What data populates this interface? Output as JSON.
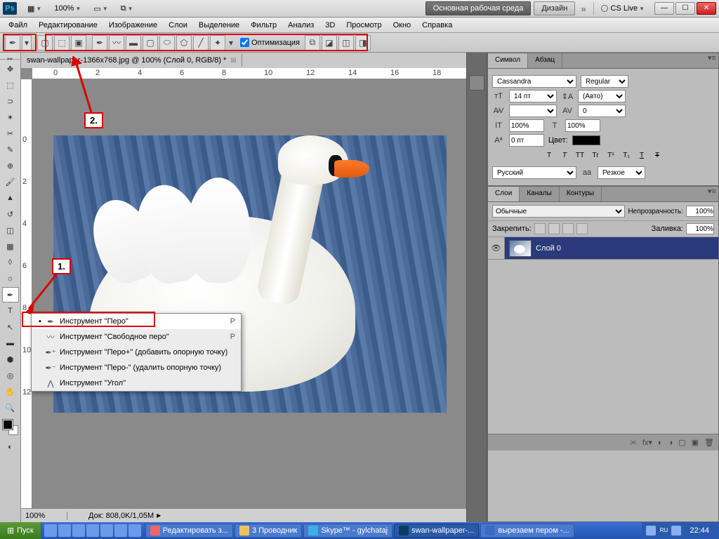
{
  "titlebar": {
    "zoom": "100%",
    "workspace_main": "Основная рабочая среда",
    "workspace_design": "Дизайн",
    "cslive": "CS Live"
  },
  "menu": [
    "Файл",
    "Редактирование",
    "Изображение",
    "Слои",
    "Выделение",
    "Фильтр",
    "Анализ",
    "3D",
    "Просмотр",
    "Окно",
    "Справка"
  ],
  "options": {
    "checkbox_label": "Оптимизация"
  },
  "document": {
    "tab_title": "swan-wallpaper-1366x768.jpg @ 100% (Слой 0, RGB/8) *"
  },
  "ruler_h": [
    "0",
    "2",
    "4",
    "6",
    "8",
    "10",
    "12",
    "14",
    "16",
    "18"
  ],
  "ruler_v": [
    "0",
    "2",
    "4",
    "6",
    "8",
    "10",
    "12"
  ],
  "status": {
    "zoom": "100%",
    "doc": "Док: 808,0K/1,05M"
  },
  "annotations": {
    "a1": "1.",
    "a2": "2."
  },
  "flyout": {
    "items": [
      {
        "icon": "pen",
        "label": "Инструмент \"Перо\"",
        "shortcut": "P",
        "selected": true
      },
      {
        "icon": "freeform-pen",
        "label": "Инструмент \"Свободное перо\"",
        "shortcut": "P"
      },
      {
        "icon": "pen-plus",
        "label": "Инструмент \"Перо+\" (добавить опорную точку)",
        "shortcut": ""
      },
      {
        "icon": "pen-minus",
        "label": "Инструмент \"Перо-\" (удалить опорную точку)",
        "shortcut": ""
      },
      {
        "icon": "convert-point",
        "label": "Инструмент \"Угол\"",
        "shortcut": ""
      }
    ]
  },
  "char_panel": {
    "tabs": [
      "Символ",
      "Абзац"
    ],
    "font": "Cassandra",
    "style": "Regular",
    "size": "14 пт",
    "leading": "(Авто)",
    "kerning": "",
    "tracking": "0",
    "vscale": "100%",
    "hscale": "100%",
    "baseline": "0 пт",
    "color_label": "Цвет:",
    "style_btns": [
      "T",
      "T",
      "TT",
      "Tr",
      "T¹",
      "T₁",
      "T",
      "Ŧ"
    ],
    "lang": "Русский",
    "aa_label": "aа",
    "aa": "Резкое"
  },
  "layers_panel": {
    "tabs": [
      "Слои",
      "Каналы",
      "Контуры"
    ],
    "blend": "Обычные",
    "opacity_label": "Непрозрачность:",
    "opacity": "100%",
    "lock_label": "Закрепить:",
    "fill_label": "Заливка:",
    "fill": "100%",
    "layer_name": "Слой 0"
  },
  "taskbar": {
    "start": "Пуск",
    "tasks": [
      {
        "label": "Редактировать з...",
        "icon": "#e66"
      },
      {
        "label": "3 Проводник",
        "icon": "#f0c060"
      },
      {
        "label": "Skype™ - gylchataj",
        "icon": "#3ab0e8"
      },
      {
        "label": "swan-wallpaper-...",
        "icon": "#0a3d62",
        "active": true
      },
      {
        "label": "вырезаем пером -...",
        "icon": "#3a6ac8"
      }
    ],
    "clock": "22:44"
  }
}
